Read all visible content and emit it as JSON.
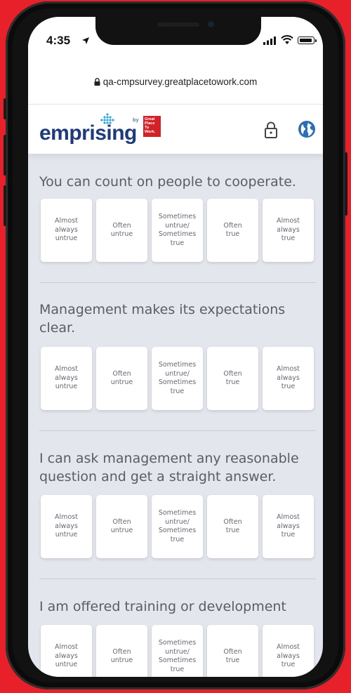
{
  "status_bar": {
    "time": "4:35"
  },
  "browser": {
    "url": "qa-cmpsurvey.greatplacetowork.com"
  },
  "site_header": {
    "logo_text": "emprising",
    "logo_by": "by",
    "logo_badge_lines": [
      "Great",
      "Place",
      "To",
      "Work."
    ],
    "brand_color": "#1f3a7a",
    "badge_color": "#d42128"
  },
  "survey": {
    "options": [
      "Almost\nalways\nuntrue",
      "Often\nuntrue",
      "Sometimes\nuntrue/\nSometimes\ntrue",
      "Often\ntrue",
      "Almost\nalways\ntrue"
    ],
    "questions": [
      {
        "text": "You can count on people to cooperate."
      },
      {
        "text": "Management makes its expectations clear."
      },
      {
        "text": "I can ask management any reasonable question and get a straight answer."
      },
      {
        "text": "I am offered training or development"
      }
    ]
  }
}
